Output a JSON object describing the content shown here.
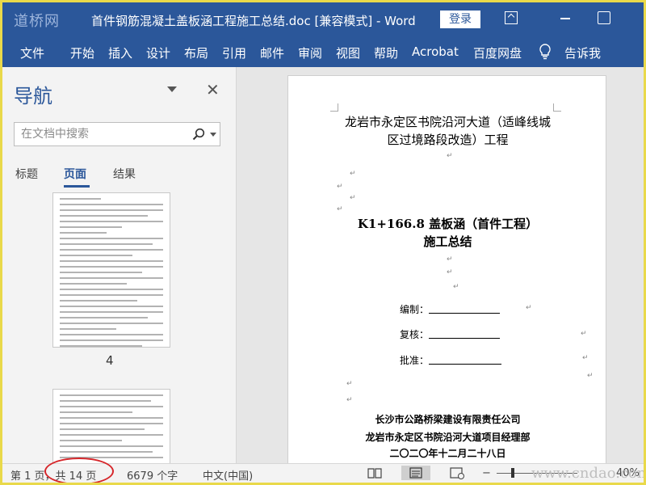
{
  "watermark_top": "道桥网",
  "window": {
    "title": "首件钢筋混凝土盖板涵工程施工总结.doc [兼容模式] - Word",
    "login_label": "登录"
  },
  "ribbon": {
    "tabs": [
      "文件",
      "开始",
      "插入",
      "设计",
      "布局",
      "引用",
      "邮件",
      "审阅",
      "视图",
      "帮助",
      "Acrobat",
      "百度网盘"
    ],
    "tell_me": "告诉我"
  },
  "nav": {
    "title": "导航",
    "search_placeholder": "在文档中搜索",
    "tabs": [
      "标题",
      "页面",
      "结果"
    ],
    "active_tab": "页面",
    "thumb_page_number": "4"
  },
  "document": {
    "title_line1": "龙岩市永定区书院沿河大道（适峰线城",
    "title_line2": "区过境路段改造）工程",
    "subtitle_line1": "K1+166.8 盖板涵（首件工程）",
    "subtitle_line2": "施工总结",
    "fields": [
      "编制：",
      "复核：",
      "批准："
    ],
    "org_line1": "长沙市公路桥梁建设有限责任公司",
    "org_line2": "龙岩市永定区书院沿河大道项目经理部",
    "date_line": "二〇二〇年十二月二十八日",
    "para_mark": "↵"
  },
  "status": {
    "page": "第 1 页，共 14 页",
    "words": "6679 个字",
    "language": "中文(中国)",
    "zoom": "40%"
  },
  "watermark_bottom": "www.cndao.com"
}
